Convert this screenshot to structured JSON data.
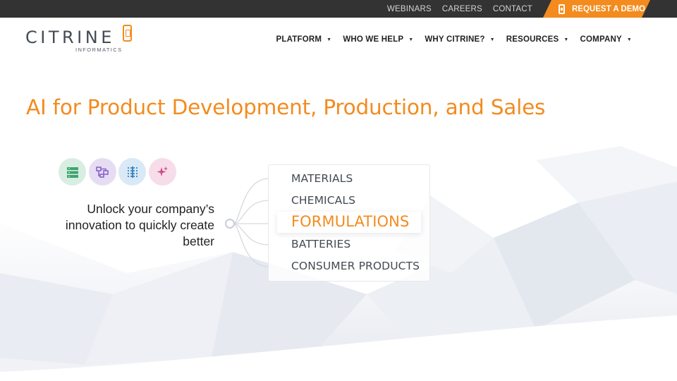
{
  "utility": {
    "links": [
      "WEBINARS",
      "CAREERS",
      "CONTACT"
    ],
    "demo_label": "REQUEST A DEMO ›"
  },
  "logo": {
    "word": "CITRINE",
    "sub": "INFORMATICS"
  },
  "nav": {
    "items": [
      "PLATFORM",
      "WHO WE HELP",
      "WHY CITRINE?",
      "RESOURCES",
      "COMPANY"
    ]
  },
  "hero": {
    "title": "AI for Product Development, Production, and Sales",
    "tagline_lines": [
      "Unlock your company’s",
      "innovation to quickly create",
      "better"
    ],
    "icons": [
      "database-icon",
      "flowchart-icon",
      "grid-icon",
      "sparkle-icon"
    ],
    "industries": [
      "MATERIALS",
      "CHEMICALS",
      "FORMULATIONS",
      "BATTERIES",
      "CONSUMER PRODUCTS"
    ],
    "active_industry": "FORMULATIONS"
  },
  "colors": {
    "accent": "#f38b1e",
    "utility_bar": "#333333",
    "text_dark": "#222222",
    "icon_green_bg": "#d8eee2",
    "icon_purple_bg": "#e6ddf3",
    "icon_blue_bg": "#d9e9f6",
    "icon_pink_bg": "#f6dde9"
  }
}
